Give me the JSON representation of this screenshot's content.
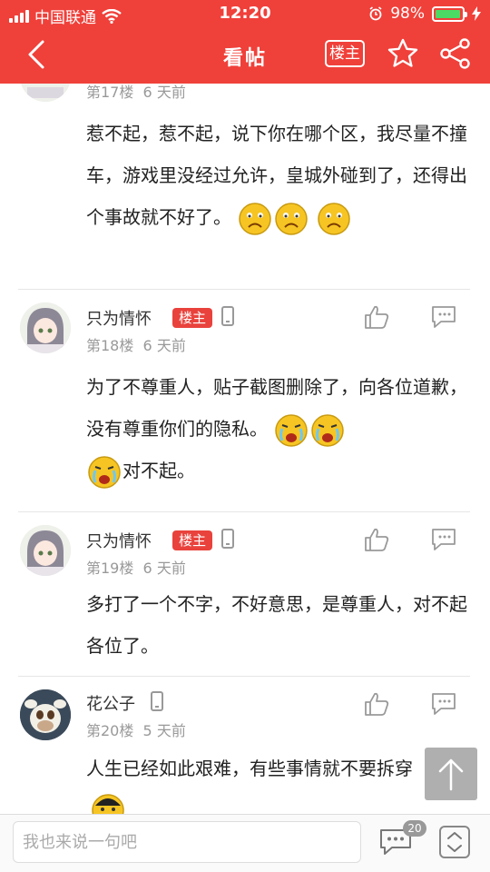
{
  "status_bar": {
    "carrier": "中国联通",
    "time": "12:20",
    "battery_percent": "98%",
    "battery_level": 0.98
  },
  "navbar": {
    "title": "看帖",
    "louzhu_button": "楼主",
    "icons": [
      "back-icon",
      "star-icon",
      "share-icon"
    ]
  },
  "badge_label": "楼主",
  "replies": [
    {
      "floor": "第17楼",
      "time": "6 天前",
      "text": "惹不起，惹不起，说下你在哪个区，我尽量不撞车，游戏里没经过允许，皇城外碰到了，还得出个事故就不好了。",
      "emoji": [
        "sad-emoji",
        "sad-emoji",
        "sad-emoji"
      ]
    },
    {
      "username": "只为情怀",
      "is_op": true,
      "floor": "第18楼",
      "time": "6 天前",
      "text_1": "为了不尊重人，贴子截图删除了，向各位道歉，没有尊重你们的隐私。",
      "text_2": "对不起。",
      "emoji": [
        "crying-emoji",
        "crying-emoji",
        "crying-emoji"
      ]
    },
    {
      "username": "只为情怀",
      "is_op": true,
      "floor": "第19楼",
      "time": "6 天前",
      "text": "多打了一个不字，不好意思，是尊重人，对不起各位了。"
    },
    {
      "username": "花公子",
      "is_op": false,
      "floor": "第20楼",
      "time": "5 天前",
      "text": "人生已经如此艰难，有些事情就不要拆穿"
    }
  ],
  "bottom_bar": {
    "input_placeholder": "我也来说一句吧",
    "comment_count": "20"
  },
  "colors": {
    "brand_red": "#f0403a",
    "badge_red": "#e9423c",
    "battery_green": "#4cd964"
  }
}
